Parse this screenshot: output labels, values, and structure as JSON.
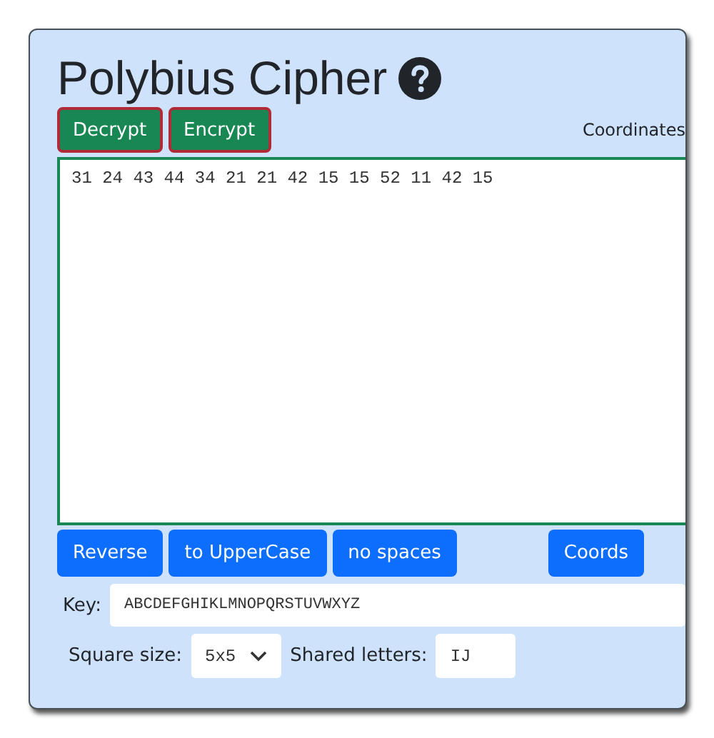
{
  "title": "Polybius Cipher",
  "mode_buttons": [
    {
      "label": "Decrypt"
    },
    {
      "label": "Encrypt"
    }
  ],
  "output_label": "Coordinates",
  "text": "31 24 43 44 34 21 21 42 15 15 52 11 42 15",
  "actions": [
    {
      "label": "Reverse"
    },
    {
      "label": "to UpperCase"
    },
    {
      "label": "no spaces"
    },
    {
      "label": "Coords"
    }
  ],
  "key": {
    "label": "Key:",
    "value": "ABCDEFGHIKLMNOPQRSTUVWXYZ"
  },
  "square_size": {
    "label": "Square size:",
    "value": "5x5"
  },
  "shared_letters": {
    "label": "Shared letters:",
    "value": "IJ"
  }
}
